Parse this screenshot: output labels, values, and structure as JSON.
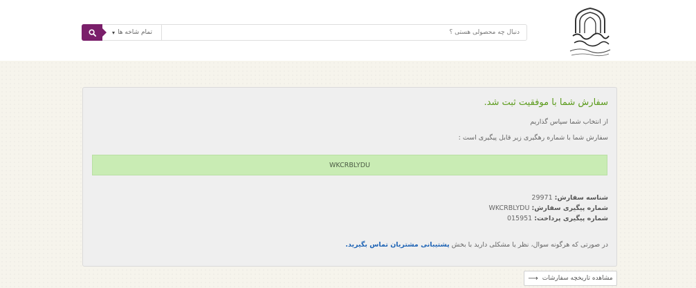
{
  "header": {
    "logo_alt": "logo",
    "search": {
      "placeholder": "دنبال چه محصولی هستی ؟",
      "category_label": "تمام شاخه ها"
    }
  },
  "order": {
    "success_title": "سفارش شما با موفقیت ثبت شد.",
    "thanks_text": "از انتخاب شما سپاس گذاریم",
    "tracking_intro": "سفارش شما با شماره رهگیری زیر قابل پیگیری است :",
    "tracking_code": "WKCRBLYDU",
    "details": [
      {
        "label": "شناسه سفارش:",
        "value": "29971"
      },
      {
        "label": "شماره پیگیری سفارش:",
        "value": "WKCRBLYDU"
      },
      {
        "label": "شماره پیگیری پرداخت:",
        "value": "015951"
      }
    ],
    "support_text": "در صورتی که هرگونه سوال، نظر یا مشکلی دارید با بخش",
    "support_link": "پشتیبانی مشتریان تماس بگیرید."
  },
  "history_button": "مشاهده تاریخچه سفارشات",
  "colors": {
    "brand": "#7a1f6a",
    "success": "#5a9a1a",
    "code_bg": "#c9ecb4",
    "link": "#1d63b5"
  }
}
